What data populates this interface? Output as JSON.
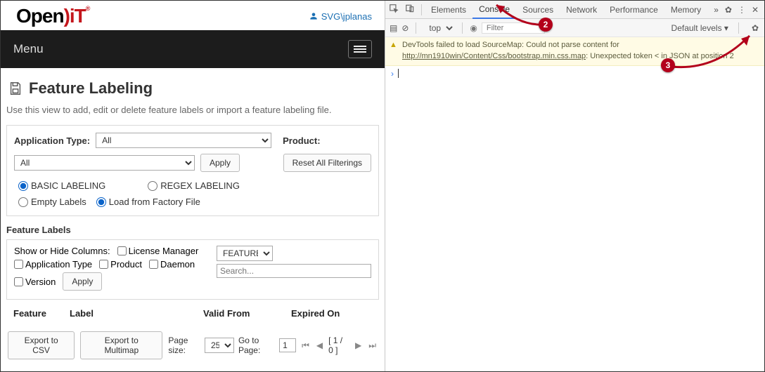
{
  "header": {
    "brand_plain1": "Open",
    "brand_red": ")iT",
    "brand_reg": "®",
    "user": "SVG\\jplanas"
  },
  "menu": {
    "label": "Menu"
  },
  "page": {
    "title": "Feature Labeling",
    "intro": "Use this view to add, edit or delete feature labels or import a feature labeling file."
  },
  "filterPanel": {
    "appTypeLabel": "Application Type:",
    "appTypeValue": "All",
    "productLabel": "Product:",
    "dropdown2": "All",
    "applyBtn": "Apply",
    "resetBtn": "Reset All Filterings",
    "radio_basic": "BASIC LABELING",
    "radio_regex": "REGEX LABELING",
    "radio_empty": "Empty Labels",
    "radio_load": "Load from Factory File"
  },
  "featLabels": {
    "section": "Feature Labels",
    "showHide": "Show or Hide Columns:",
    "chk_license": "License Manager",
    "chk_apptype": "Application Type",
    "chk_product": "Product",
    "chk_daemon": "Daemon",
    "chk_version": "Version",
    "apply": "Apply",
    "featureSel": "FEATURE",
    "searchPh": "Search..."
  },
  "table": {
    "th_feature": "Feature",
    "th_label": "Label",
    "th_valid": "Valid From",
    "th_exp": "Expired On"
  },
  "pager": {
    "exportCsv": "Export to CSV",
    "exportMulti": "Export to Multimap",
    "pageSize": "Page size:",
    "pageSizeVal": "25",
    "goTo": "Go to Page:",
    "goToVal": "1",
    "pos": "[ 1 / 0 ]"
  },
  "devtools": {
    "tabs": [
      "Elements",
      "Console",
      "Sources",
      "Network",
      "Performance",
      "Memory"
    ],
    "topContext": "top",
    "filterPh": "Filter",
    "levels": "Default levels ▾",
    "warn_pre": "DevTools failed to load SourceMap: Could not parse content for ",
    "warn_link": "http://mn1910win/Content/Css/bootstrap.min.css.map",
    "warn_post": ": Unexpected token < in JSON at position 2"
  },
  "annotations": {
    "n2": "2",
    "n3": "3"
  }
}
